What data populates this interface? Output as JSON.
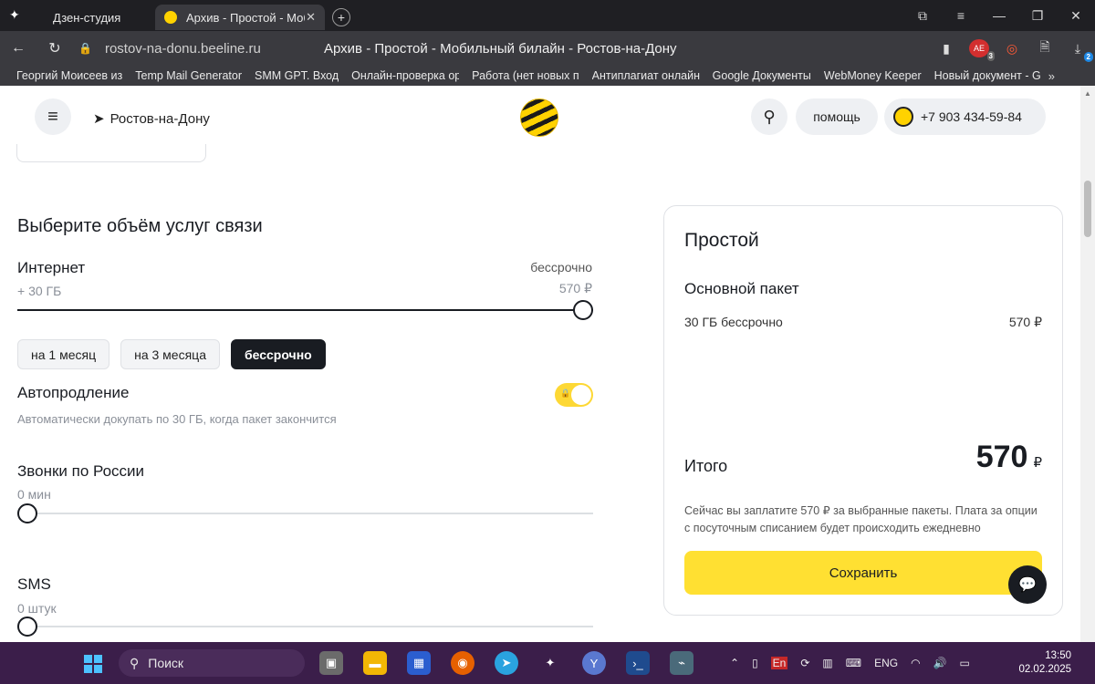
{
  "browser": {
    "tabs": [
      {
        "label": "Дзен-студия"
      },
      {
        "label": "Архив - Простой - Моб",
        "close": "✕"
      }
    ],
    "url": "rostov-na-donu.beeline.ru",
    "page_title": "Архив - Простой - Мобильный билайн - Ростов-на-Дону",
    "bookmarks": [
      "Георгий Моисеев из",
      "Temp Mail Generator",
      "SMM GPT. Вход",
      "Онлайн-проверка ор",
      "Работа (нет новых п",
      "Антиплагиат онлайн",
      "Google Документы",
      "WebMoney Keeper",
      "Новый документ - G"
    ],
    "bookmarks_more": "»",
    "ext_badges": {
      "ae": "3",
      "shield": "2"
    }
  },
  "header": {
    "city": "Ростов-на-Дону",
    "help": "помощь",
    "phone": "+7 903 434-59-84"
  },
  "main": {
    "section_title": "Выберите объём услуг связи",
    "internet": {
      "label": "Интернет",
      "sub": "+ 30 ГБ",
      "term": "бессрочно",
      "price": "570 ₽",
      "level": 1.0
    },
    "chips": [
      {
        "label": "на 1 месяц",
        "active": false
      },
      {
        "label": "на 3 месяца",
        "active": false
      },
      {
        "label": "бессрочно",
        "active": true
      }
    ],
    "autorenew": {
      "label": "Автопродление",
      "sub": "Автоматически докупать по 30 ГБ, когда пакет закончится",
      "on": true
    },
    "calls": {
      "label": "Звонки по России",
      "sub": "0 мин",
      "level": 0
    },
    "sms": {
      "label": "SMS",
      "sub": "0 штук",
      "level": 0
    }
  },
  "summary": {
    "title": "Простой",
    "package_title": "Основной пакет",
    "line_label": "30 ГБ бессрочно",
    "line_value": "570 ₽",
    "total_label": "Итого",
    "total_value": "570",
    "total_currency": "₽",
    "note": "Сейчас вы заплатите 570 ₽ за выбранные пакеты. Плата за опции с посуточным списанием будет происходить ежедневно",
    "save": "Сохранить"
  },
  "taskbar": {
    "search": "Поиск",
    "lang": "ENG",
    "time": "13:50",
    "date": "02.02.2025"
  },
  "colors": {
    "accent": "#ffe032",
    "dark": "#191c22",
    "taskbar": "#3b1e4a"
  }
}
